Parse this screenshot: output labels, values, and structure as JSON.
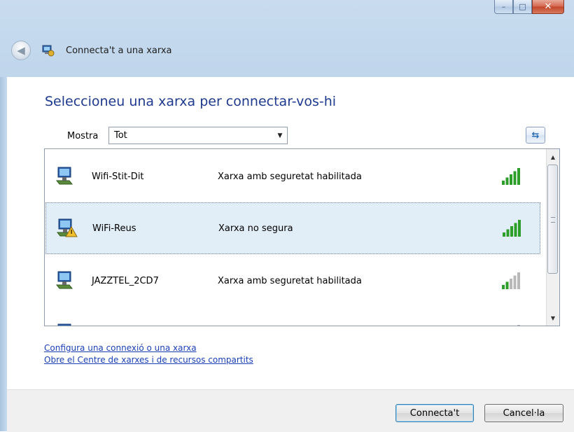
{
  "window": {
    "title": "Connecta't a una xarxa",
    "controls": {
      "minimize": "–",
      "maximize": "□",
      "close": "✕"
    }
  },
  "nav": {
    "back_glyph": "◀"
  },
  "main": {
    "heading": "Seleccioneu una xarxa per connectar-vos-hi",
    "filter": {
      "label": "Mostra",
      "value": "Tot"
    },
    "refresh_glyph": "⇆"
  },
  "networks": [
    {
      "name": "Wifi-Stit-Dit",
      "status": "Xarxa amb seguretat habilitada",
      "secure": true,
      "selected": false,
      "signal_bars": 5
    },
    {
      "name": "WiFi-Reus",
      "status": "Xarxa no segura",
      "secure": false,
      "selected": true,
      "signal_bars": 5
    },
    {
      "name": "JAZZTEL_2CD7",
      "status": "Xarxa amb seguretat habilitada",
      "secure": true,
      "selected": false,
      "signal_bars": 2
    },
    {
      "name": "",
      "status": "",
      "secure": true,
      "selected": false,
      "signal_bars": 1
    }
  ],
  "links": {
    "setup": "Configura una connexió o una xarxa",
    "center": "Obre el Centre de xarxes i de recursos compartits"
  },
  "buttons": {
    "connect": "Connecta't",
    "cancel": "Cancel·la"
  },
  "colors": {
    "heading": "#1e3a8e",
    "link": "#1a3fb5",
    "signal_active": "#2e9e2a",
    "signal_inactive": "#b8b8b8",
    "selected_row": "#e1edf7"
  }
}
